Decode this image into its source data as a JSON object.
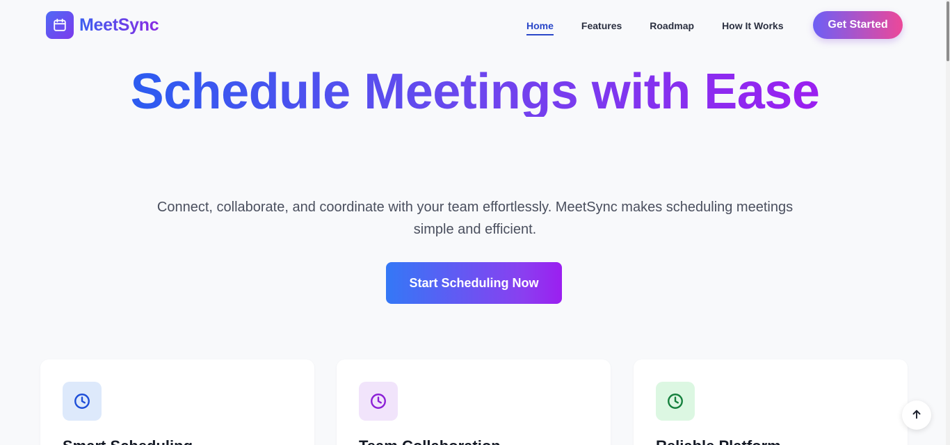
{
  "brand": {
    "name": "MeetSync",
    "logo_icon": "calendar-icon"
  },
  "nav": {
    "items": [
      {
        "label": "Home",
        "active": true
      },
      {
        "label": "Features",
        "active": false
      },
      {
        "label": "Roadmap",
        "active": false
      },
      {
        "label": "How It Works",
        "active": false
      }
    ],
    "cta_label": "Get Started"
  },
  "hero": {
    "title": "Schedule Meetings with Ease",
    "subtitle": "Connect, collaborate, and coordinate with your team effortlessly. MeetSync makes scheduling meetings simple and efficient.",
    "cta_label": "Start Scheduling Now"
  },
  "features": [
    {
      "title": "Smart Scheduling",
      "icon": "clock-icon",
      "icon_color": "#1d4ed8",
      "icon_bg": "#dde9fb"
    },
    {
      "title": "Team Collaboration",
      "icon": "clock-icon",
      "icon_color": "#8b1fd6",
      "icon_bg": "#f1e4fb"
    },
    {
      "title": "Reliable Platform",
      "icon": "clock-icon",
      "icon_color": "#15803d",
      "icon_bg": "#dcf7e2"
    }
  ],
  "colors": {
    "brand_gradient_start": "#3b5ff0",
    "brand_gradient_end": "#8a2be2",
    "nav_active": "#2a47c8",
    "get_started_gradient_end": "#ec4899",
    "page_background": "#f8f9fb"
  },
  "scroll_top_icon": "arrow-up-icon"
}
